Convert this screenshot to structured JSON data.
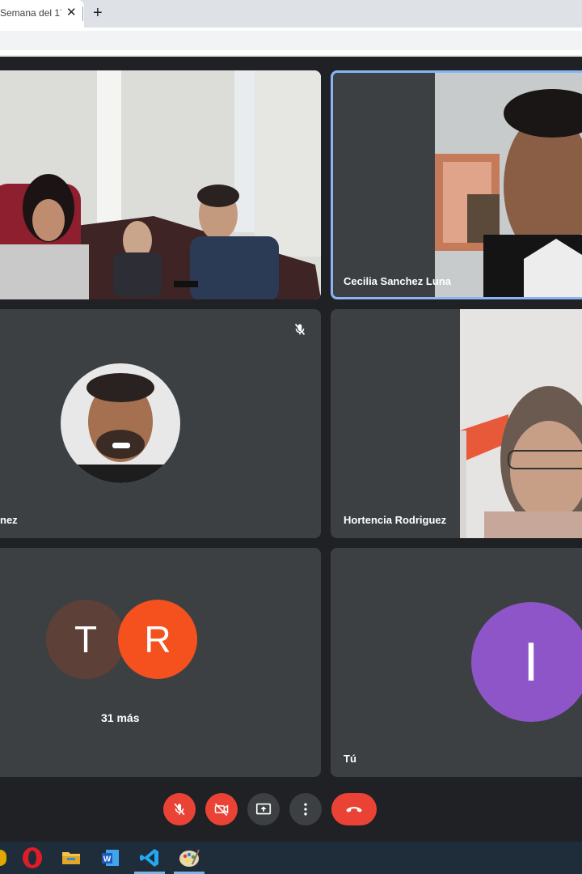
{
  "browser": {
    "tab_title": "Semana del 1´",
    "close_glyph": "✕",
    "new_tab_glyph": "+"
  },
  "meeting": {
    "tiles": [
      {
        "name": "",
        "type": "video"
      },
      {
        "name": "Cecilia Sanchez Luna",
        "type": "video",
        "active_speaker": true
      },
      {
        "name": "nez",
        "type": "avatar-photo",
        "muted": true
      },
      {
        "name": "Hortencia Rodriguez",
        "type": "video"
      },
      {
        "name": "31 más",
        "type": "overflow",
        "avatars": [
          {
            "letter": "T",
            "color": "#5d4037"
          },
          {
            "letter": "R",
            "color": "#f4511e"
          }
        ]
      },
      {
        "name": "Tú",
        "type": "self",
        "avatar": {
          "letter": "I",
          "color": "#8e55c9"
        }
      }
    ]
  },
  "controls": {
    "icons": [
      "mic-off-icon",
      "camera-off-icon",
      "present-screen-icon",
      "more-options-icon",
      "end-call-icon"
    ]
  },
  "taskbar": {
    "icons": [
      "opera-icon",
      "file-explorer-icon",
      "word-icon",
      "vscode-icon",
      "paint-icon"
    ]
  },
  "colors": {
    "tile_bg": "#3c4043",
    "page_bg": "#202124",
    "danger": "#ea4335",
    "active_border": "#8ab4f8"
  }
}
